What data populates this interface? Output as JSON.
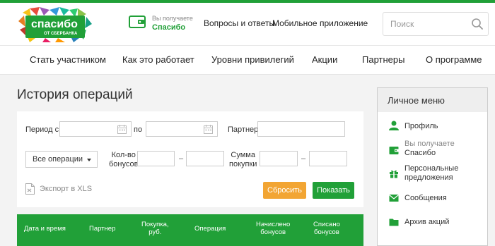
{
  "header": {
    "logo": {
      "text": "спасибо",
      "subtext": "ОТ СБЕРБАНКА"
    },
    "promo": {
      "small": "Вы получаете",
      "brand": "Спасибо"
    },
    "links": [
      "Вопросы и ответы",
      "Мобильное приложение"
    ],
    "search": {
      "placeholder": "Поиск"
    }
  },
  "nav": [
    "Стать участником",
    "Как это работает",
    "Уровни привилегий",
    "Акции",
    "Партнеры",
    "О программе"
  ],
  "page": {
    "title": "История операций"
  },
  "filter": {
    "period_from_label": "Период с",
    "period_to_label": "по",
    "partner_label": "Партнер",
    "operations_select": "Все операции",
    "bonus_count_label": [
      "Кол-во",
      "бонусов"
    ],
    "purchase_sum_label": [
      "Сумма",
      "покупки"
    ],
    "dash": "–",
    "export_label": "Экспорт в XLS",
    "reset_label": "Сбросить",
    "show_label": "Показать"
  },
  "table": {
    "headers": [
      [
        "Дата и время"
      ],
      [
        "Партнер"
      ],
      [
        "Покупка,",
        "руб."
      ],
      [
        "Операция"
      ],
      [
        "Начислено",
        "бонусов"
      ],
      [
        "Списано",
        "бонусов"
      ]
    ]
  },
  "sidebar": {
    "title": "Личное меню",
    "items": [
      {
        "lines": [
          "Профиль"
        ],
        "icon": "user-icon"
      },
      {
        "lines": [
          "Вы получаете",
          "Спасибо"
        ],
        "icon": "wallet-icon"
      },
      {
        "lines": [
          "Персональные",
          "предложения"
        ],
        "icon": "gift-icon"
      },
      {
        "lines": [
          "Сообщения"
        ],
        "icon": "envelope-icon"
      },
      {
        "lines": [
          "Архив акций"
        ],
        "icon": "folder-icon"
      }
    ]
  },
  "colors": {
    "accent": "#21a038",
    "orange": "#f2a533",
    "text": "#333333"
  }
}
